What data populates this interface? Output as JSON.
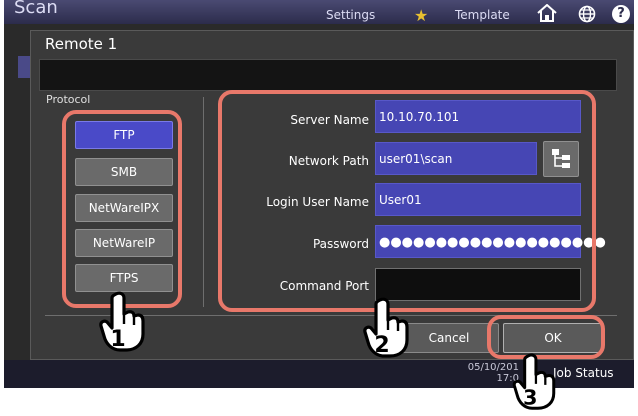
{
  "app": {
    "title": "Scan"
  },
  "topbar": {
    "settings_label": "Settings",
    "template_label": "Template",
    "help_label": "?"
  },
  "background": {
    "date": "05/10/201",
    "time": "17:0",
    "job_status_label": "Job Status"
  },
  "dialog": {
    "title": "Remote 1",
    "protocol_label": "Protocol",
    "protocols": [
      {
        "label": "FTP",
        "selected": true
      },
      {
        "label": "SMB",
        "selected": false
      },
      {
        "label": "NetWareIPX",
        "selected": false
      },
      {
        "label": "NetWareIP",
        "selected": false
      },
      {
        "label": "FTPS",
        "selected": false
      }
    ],
    "fields": {
      "server_name": {
        "label": "Server Name",
        "value": "10.10.70.101"
      },
      "network_path": {
        "label": "Network Path",
        "value": "user01\\scan"
      },
      "login_user_name": {
        "label": "Login User Name",
        "value": "User01"
      },
      "password": {
        "label": "Password",
        "value": "●●●●●●●●●●●●●●●●●●●●"
      },
      "command_port": {
        "label": "Command Port",
        "value": ""
      }
    },
    "cancel_label": "Cancel",
    "ok_label": "OK"
  },
  "callouts": {
    "step1": "1",
    "step2": "2",
    "step3": "3"
  },
  "colors": {
    "accent": "#4646b4",
    "callout": "#e8786a",
    "selected": "#4a4ac8"
  }
}
